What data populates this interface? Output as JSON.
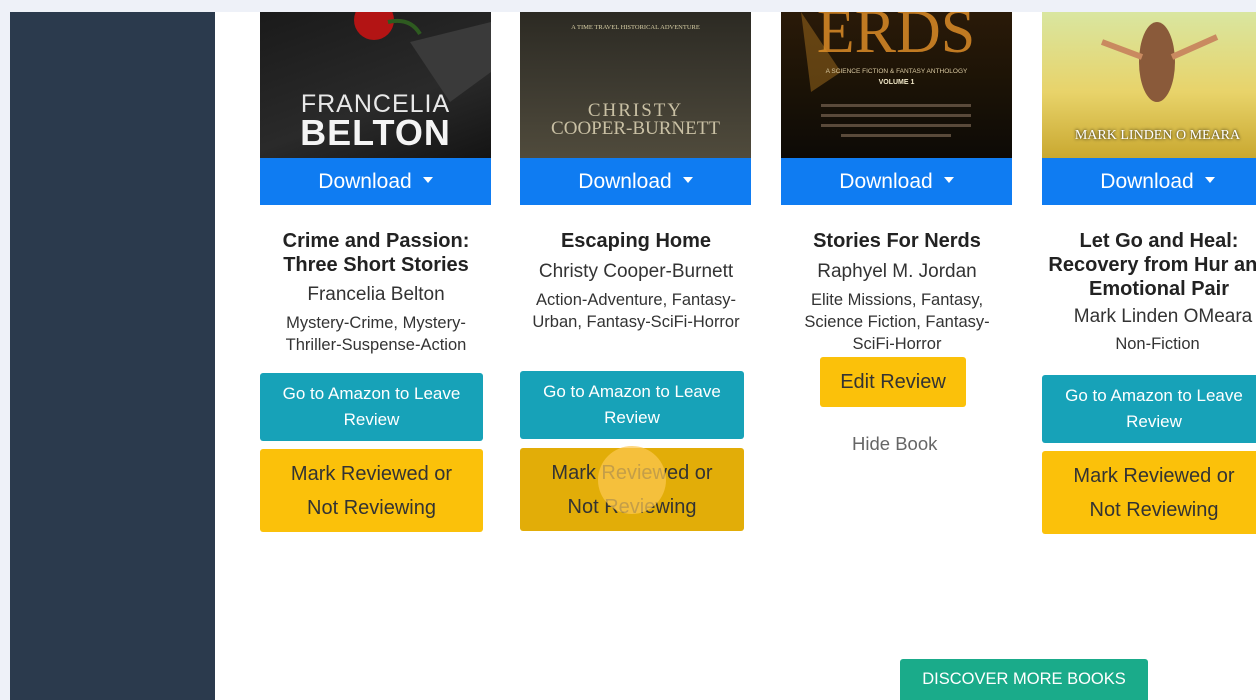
{
  "books": [
    {
      "cover_text": [
        "FRANCELIA",
        "BELTON"
      ],
      "download_label": "Download",
      "title": "Crime and Passion: Three Short Stories",
      "author": "Francelia Belton",
      "genres": "Mystery-Crime, Mystery-Thriller-Suspense-Action",
      "amazon_label": "Go to Amazon to Leave Review",
      "mark_label": "Mark Reviewed or Not Reviewing"
    },
    {
      "cover_text": [
        "A TIME TRAVEL HISTORICAL ADVENTURE",
        "CHRISTY",
        "COOPER-BURNETT"
      ],
      "download_label": "Download",
      "title": "Escaping Home",
      "author": "Christy Cooper-Burnett",
      "genres": "Action-Adventure, Fantasy-Urban, Fantasy-SciFi-Horror",
      "amazon_label": "Go to Amazon to Leave Review",
      "mark_label": "Mark Reviewed or Not Reviewing"
    },
    {
      "cover_text": [
        "A SCIENCE FICTION & FANTASY ANTHOLOGY",
        "VOLUME 1"
      ],
      "download_label": "Download",
      "title": "Stories For Nerds",
      "author": "Raphyel M. Jordan",
      "genres": "Elite Missions, Fantasy, Science Fiction, Fantasy-SciFi-Horror",
      "edit_label": "Edit Review",
      "hide_label": "Hide Book"
    },
    {
      "cover_text": [
        "MARK LINDEN O MEARA"
      ],
      "download_label": "Download",
      "title": "Let Go and Heal: Recovery from Hur and Emotional Pair",
      "author": "Mark Linden OMeara",
      "genres": "Non-Fiction",
      "amazon_label": "Go to Amazon to Leave Review",
      "mark_label": "Mark Reviewed or Not Reviewing"
    }
  ],
  "discover_label": "DISCOVER MORE BOOKS",
  "colors": {
    "sidebar": "#2b3a4d",
    "download": "#0f7cf2",
    "amazon_button": "#17a2b8",
    "mark_button": "#fbc10a",
    "discover_button": "#1aab8a"
  }
}
